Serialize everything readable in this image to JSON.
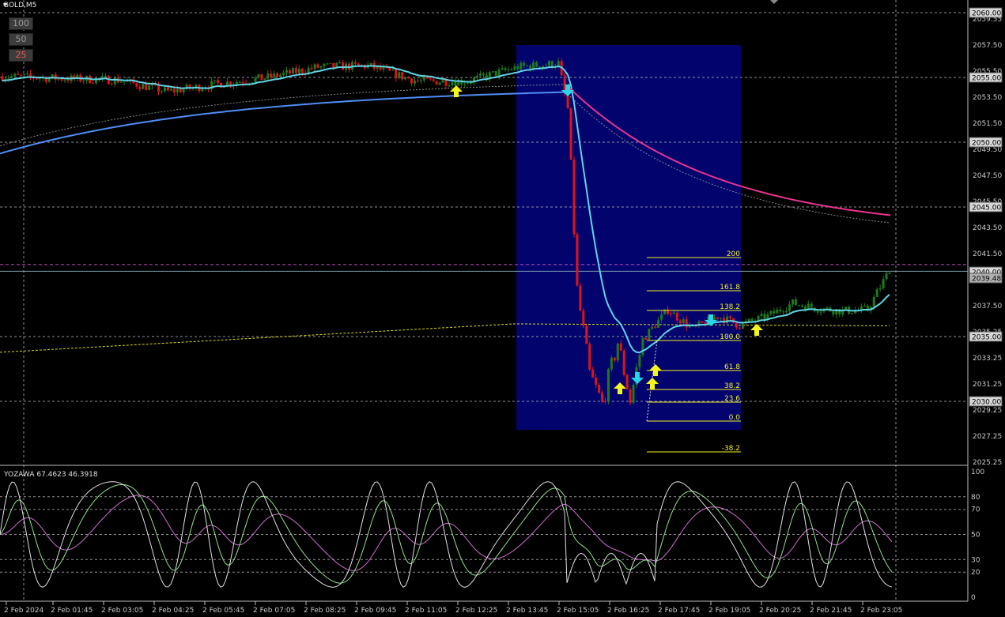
{
  "symbol": "GOLD,M5",
  "zoom_buttons": [
    "100",
    "50",
    "25"
  ],
  "indicator_label": "YOZAWA 67.4623 46.3918",
  "colors": {
    "background": "#000000",
    "bull": "#1e7a1e",
    "bear": "#e01414",
    "fast_ma": "#5fd3e6",
    "slow_ma_before": "#4f8ef5",
    "slow_ma_after": "#e8338f",
    "selection": "#03036e",
    "fib": "#f0f020",
    "grid": "#a9a9a9",
    "arrow_up": "#f5f51e",
    "arrow_down": "#26d8e6"
  },
  "price_axis": {
    "range": [
      2024.5,
      2060.5
    ],
    "ticks": [
      "2059.55",
      "2057.50",
      "2055.50",
      "2053.50",
      "2051.50",
      "2049.50",
      "2047.50",
      "2045.50",
      "2043.50",
      "2041.50",
      "2039.50",
      "2037.50",
      "2035.25",
      "2033.25",
      "2031.25",
      "2029.25",
      "2027.25",
      "2025.25"
    ],
    "highlight_labels": [
      "2060.00",
      "2055.00",
      "2050.00",
      "2045.00",
      "2040.00",
      "2039.48",
      "2035.00",
      "2030.00"
    ]
  },
  "time_axis": {
    "labels": [
      "2 Feb 2024",
      "2 Feb 01:45",
      "2 Feb 03:05",
      "2 Feb 04:25",
      "2 Feb 05:45",
      "2 Feb 07:05",
      "2 Feb 08:25",
      "2 Feb 09:45",
      "2 Feb 11:05",
      "2 Feb 12:25",
      "2 Feb 13:45",
      "2 Feb 15:05",
      "2 Feb 16:25",
      "2 Feb 17:45",
      "2 Feb 19:05",
      "2 Feb 20:25",
      "2 Feb 21:45",
      "2 Feb 23:05"
    ]
  },
  "oscillator_axis": {
    "range": [
      0,
      100
    ],
    "ticks": [
      "100",
      "80",
      "70",
      "50",
      "30",
      "20",
      "0"
    ]
  },
  "fib_levels": [
    "200",
    "161.8",
    "138.2",
    "100.0",
    "61.8",
    "38.2",
    "23.6",
    "0.0",
    "-38.2"
  ],
  "chart_data": {
    "type": "line",
    "title": "GOLD,M5",
    "series": [
      {
        "name": "price",
        "x": [
          "00:00",
          "01:45",
          "03:05",
          "04:25",
          "05:45",
          "07:05",
          "08:25",
          "09:45",
          "11:05",
          "12:25",
          "13:45",
          "14:50",
          "15:05",
          "15:20",
          "15:40",
          "16:00",
          "16:25",
          "16:45",
          "17:05",
          "17:45",
          "18:25",
          "19:05",
          "19:40",
          "20:25",
          "21:05",
          "21:45",
          "22:25",
          "23:05",
          "23:40"
        ],
        "values": [
          2054.6,
          2054.4,
          2054.3,
          2053.4,
          2054.0,
          2054.5,
          2055.3,
          2055.4,
          2054.2,
          2054.2,
          2055.3,
          2055.6,
          2052.0,
          2038.0,
          2031.5,
          2029.2,
          2034.0,
          2029.5,
          2034.2,
          2036.5,
          2035.0,
          2036.0,
          2035.3,
          2036.0,
          2037.0,
          2036.6,
          2036.4,
          2036.5,
          2039.6
        ]
      }
    ],
    "ylim": [
      2024.5,
      2060.5
    ]
  }
}
